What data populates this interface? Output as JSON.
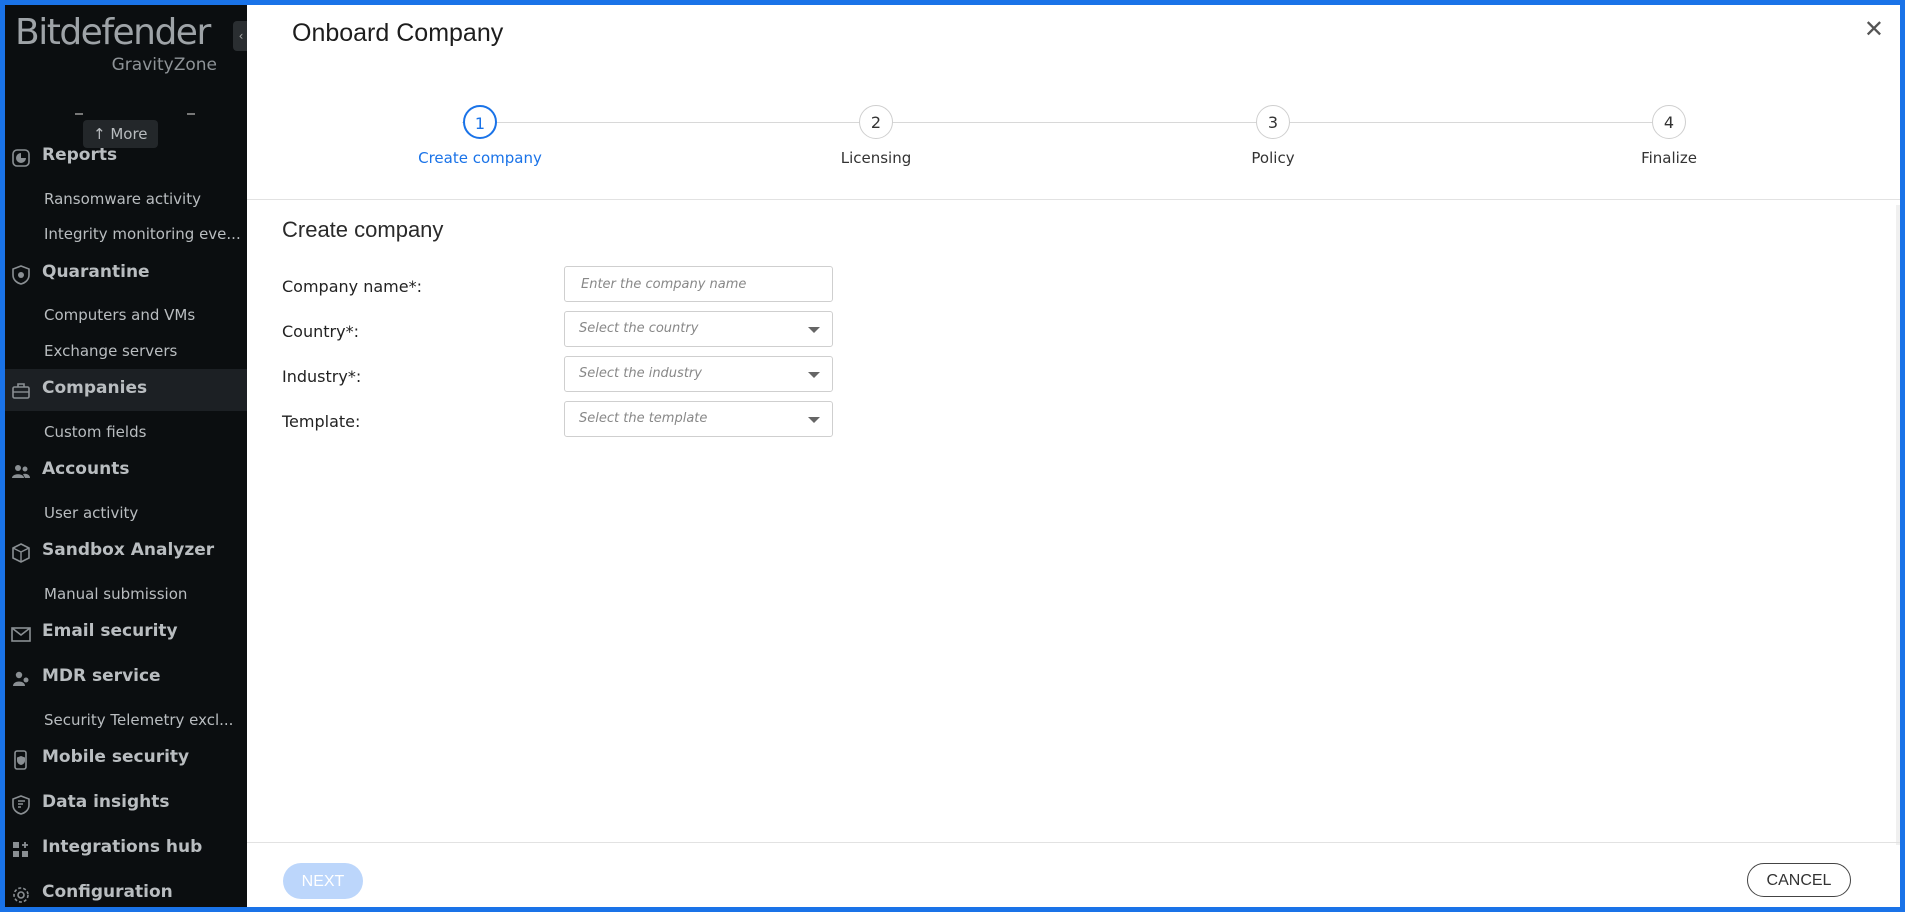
{
  "sidebar": {
    "brand": "Bitdefender",
    "brand_sub": "GravityZone",
    "more_label": "↑ More",
    "items": [
      {
        "label": "Reports",
        "icon": "reports-icon",
        "subs": [
          "Ransomware activity",
          "Integrity monitoring eve..."
        ]
      },
      {
        "label": "Quarantine",
        "icon": "quarantine-shield-icon",
        "subs": [
          "Computers and VMs",
          "Exchange servers"
        ]
      },
      {
        "label": "Companies",
        "icon": "briefcase-icon",
        "subs": [
          "Custom fields"
        ],
        "selected": true
      },
      {
        "label": "Accounts",
        "icon": "users-icon",
        "subs": [
          "User activity"
        ]
      },
      {
        "label": "Sandbox Analyzer",
        "icon": "cube-icon",
        "subs": [
          "Manual submission"
        ]
      },
      {
        "label": "Email security",
        "icon": "envelope-shield-icon",
        "subs": []
      },
      {
        "label": "MDR service",
        "icon": "mdr-users-icon",
        "subs": [
          "Security Telemetry excl..."
        ]
      },
      {
        "label": "Mobile security",
        "icon": "mobile-shield-icon",
        "subs": []
      },
      {
        "label": "Data insights",
        "icon": "flag-shield-icon",
        "subs": []
      },
      {
        "label": "Integrations hub",
        "icon": "grid-plus-icon",
        "subs": []
      },
      {
        "label": "Configuration",
        "icon": "gear-icon",
        "subs": []
      }
    ]
  },
  "dialog": {
    "title": "Onboard Company",
    "close_icon": "close-icon",
    "steps": [
      {
        "number": "1",
        "label": "Create company",
        "active": true
      },
      {
        "number": "2",
        "label": "Licensing"
      },
      {
        "number": "3",
        "label": "Policy"
      },
      {
        "number": "4",
        "label": "Finalize"
      }
    ],
    "section_title": "Create company",
    "form": {
      "company_name_label": "Company name*:",
      "company_name_placeholder": "Enter the company name",
      "country_label": "Country*:",
      "country_placeholder": "Select the country",
      "industry_label": "Industry*:",
      "industry_placeholder": "Select the industry",
      "template_label": "Template:",
      "template_placeholder": "Select the template"
    },
    "next_label": "NEXT",
    "cancel_label": "CANCEL"
  },
  "colors": {
    "accent": "#1a73e8",
    "sidebar_bg": "#0b0e10",
    "next_disabled": "#bcd6fb"
  }
}
